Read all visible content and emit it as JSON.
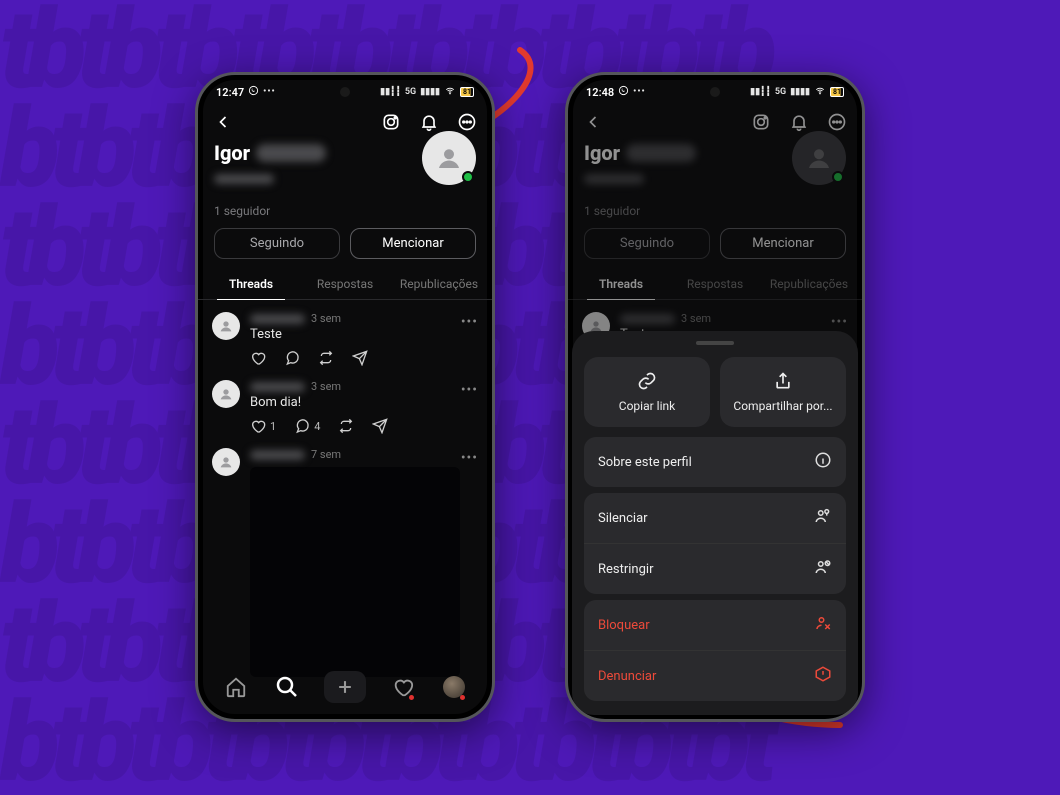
{
  "background_color": "#4e19b8",
  "arrow_color": "#e23a2e",
  "phone1": {
    "status": {
      "time": "12:47",
      "network": "5G",
      "battery": "81"
    },
    "profile": {
      "name_visible": "Igor",
      "followers": "1 seguidor"
    },
    "buttons": {
      "follow": "Seguindo",
      "mention": "Mencionar"
    },
    "tabs": {
      "threads": "Threads",
      "replies": "Respostas",
      "reposts": "Republicações"
    },
    "posts": [
      {
        "time": "3 sem",
        "text": "Teste",
        "likes": "",
        "comments": ""
      },
      {
        "time": "3 sem",
        "text": "Bom dia!",
        "likes": "1",
        "comments": "4"
      },
      {
        "time": "7 sem",
        "text": "",
        "has_image": true
      }
    ]
  },
  "phone2": {
    "status": {
      "time": "12:48",
      "network": "5G",
      "battery": "81"
    },
    "profile": {
      "name_visible": "Igor",
      "followers": "1 seguidor"
    },
    "buttons": {
      "follow": "Seguindo",
      "mention": "Mencionar"
    },
    "tabs": {
      "threads": "Threads",
      "replies": "Respostas",
      "reposts": "Republicações"
    },
    "posts": [
      {
        "time": "3 sem",
        "text": "Teste"
      }
    ],
    "sheet": {
      "copy_link": "Copiar link",
      "share_via": "Compartilhar por...",
      "about": "Sobre este perfil",
      "mute": "Silenciar",
      "restrict": "Restringir",
      "block": "Bloquear",
      "report": "Denunciar"
    }
  }
}
